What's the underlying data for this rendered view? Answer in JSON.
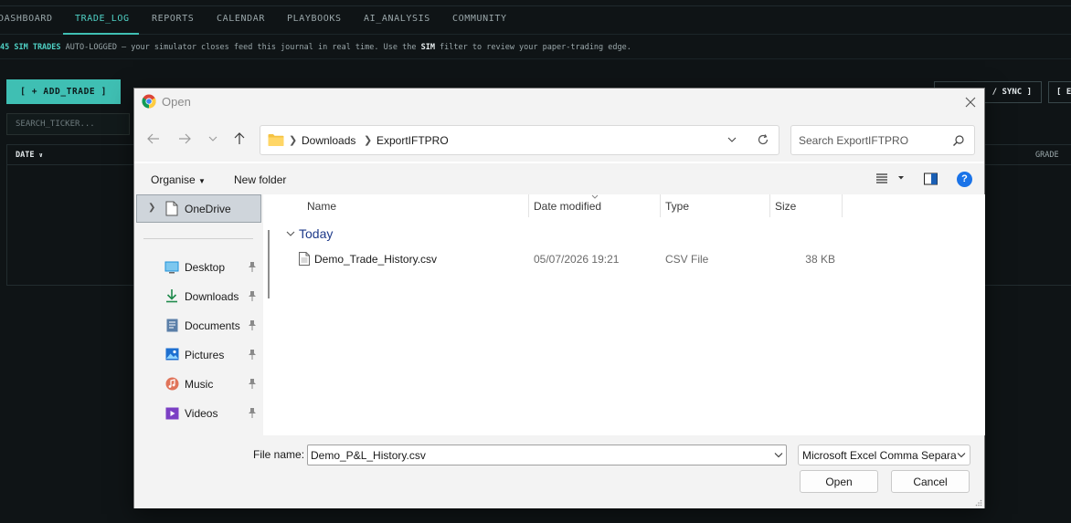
{
  "app": {
    "nav": [
      "DASHBOARD",
      "TRADE_LOG",
      "REPORTS",
      "CALENDAR",
      "PLAYBOOKS",
      "AI_ANALYSIS",
      "COMMUNITY"
    ],
    "notice": {
      "highlight": "45 SIM TRADES",
      "part1": " AUTO-LOGGED — your simulator closes feed this journal in real time. Use the ",
      "bold": "SIM",
      "part2": " filter to review your paper-trading edge."
    },
    "add_trade": "[ + ADD_TRADE ]",
    "sync": "/ SYNC ]",
    "edge_button": "[ E",
    "search_placeholder": "SEARCH_TICKER...",
    "table": {
      "date_header": "DATE",
      "grade_header": "GRADE"
    },
    "accent": "#3fbfb3"
  },
  "dialog": {
    "title": "Open",
    "breadcrumb": [
      "Downloads",
      "ExportIFTPRO"
    ],
    "search_placeholder": "Search ExportIFTPRO",
    "organise": "Organise",
    "new_folder": "New folder",
    "help": "?",
    "nav": {
      "onedrive": "OneDrive",
      "items": [
        {
          "label": "Desktop",
          "icon": "desktop-icon"
        },
        {
          "label": "Downloads",
          "icon": "download-icon"
        },
        {
          "label": "Documents",
          "icon": "documents-icon"
        },
        {
          "label": "Pictures",
          "icon": "pictures-icon"
        },
        {
          "label": "Music",
          "icon": "music-icon"
        },
        {
          "label": "Videos",
          "icon": "videos-icon"
        }
      ]
    },
    "columns": [
      "Name",
      "Date modified",
      "Type",
      "Size"
    ],
    "group": "Today",
    "files": [
      {
        "name": "Demo_Trade_History.csv",
        "date": "05/07/2026 19:21",
        "type": "CSV File",
        "size": "38 KB"
      }
    ],
    "file_name_label": "File name:",
    "file_name_value": "Demo_P&L_History.csv",
    "file_type": "Microsoft Excel Comma Separa",
    "open_button": "Open",
    "cancel_button": "Cancel"
  }
}
